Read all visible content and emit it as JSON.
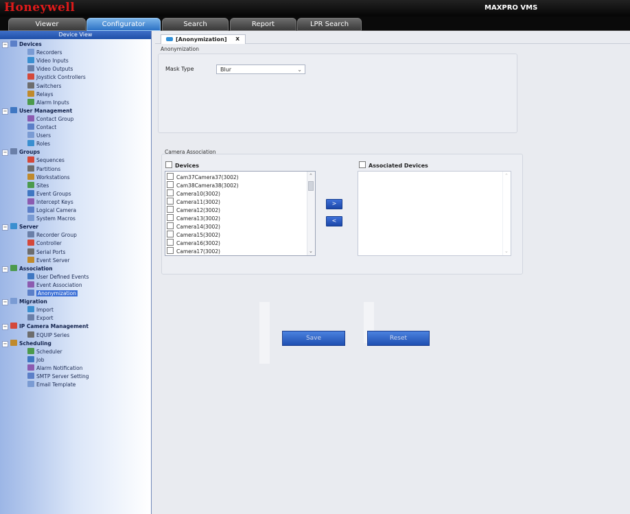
{
  "header": {
    "brand": "Honeywell",
    "product": "MAXPRO VMS",
    "tabs": [
      {
        "label": "Viewer",
        "active": false
      },
      {
        "label": "Configurator",
        "active": true
      },
      {
        "label": "Search",
        "active": false
      },
      {
        "label": "Report",
        "active": false
      },
      {
        "label": "LPR Search",
        "active": false
      }
    ]
  },
  "sidebar": {
    "title": "Device View",
    "items": [
      {
        "label": "Devices",
        "group": true
      },
      {
        "label": "Recorders"
      },
      {
        "label": "Video Inputs"
      },
      {
        "label": "Video Outputs"
      },
      {
        "label": "Joystick Controllers"
      },
      {
        "label": "Switchers"
      },
      {
        "label": "Relays"
      },
      {
        "label": "Alarm Inputs"
      },
      {
        "label": "User Management",
        "group": true
      },
      {
        "label": "Contact Group"
      },
      {
        "label": "Contact"
      },
      {
        "label": "Users"
      },
      {
        "label": "Roles"
      },
      {
        "label": "Groups",
        "group": true
      },
      {
        "label": "Sequences"
      },
      {
        "label": "Partitions"
      },
      {
        "label": "Workstations"
      },
      {
        "label": "Sites"
      },
      {
        "label": "Event Groups"
      },
      {
        "label": "Intercept Keys"
      },
      {
        "label": "Logical Camera"
      },
      {
        "label": "System Macros"
      },
      {
        "label": "Server",
        "group": true
      },
      {
        "label": "Recorder Group"
      },
      {
        "label": "Controller"
      },
      {
        "label": "Serial Ports"
      },
      {
        "label": "Event Server"
      },
      {
        "label": "Association",
        "group": true
      },
      {
        "label": "User Defined Events"
      },
      {
        "label": "Event Association"
      },
      {
        "label": "Anonymization",
        "selected": true
      },
      {
        "label": "Migration",
        "group": true
      },
      {
        "label": "Import"
      },
      {
        "label": "Export"
      },
      {
        "label": "IP Camera Management",
        "group": true
      },
      {
        "label": "EQUIP Series"
      },
      {
        "label": "Scheduling",
        "group": true
      },
      {
        "label": "Scheduler"
      },
      {
        "label": "Job"
      },
      {
        "label": "Alarm Notification"
      },
      {
        "label": "SMTP Server Setting"
      },
      {
        "label": "Email Template"
      }
    ]
  },
  "doc_tab": {
    "label": "[Anonymization]",
    "close": "x"
  },
  "anonymization": {
    "section_title": "Anonymization",
    "mask_type_label": "Mask Type",
    "mask_type_value": "Blur"
  },
  "camera_association": {
    "section_title": "Camera Association",
    "devices_label": "Devices",
    "associated_label": "Associated Devices",
    "devices": [
      "Cam37Camera37(3002)",
      "Cam38Camera38(3002)",
      "Camera10(3002)",
      "Camera11(3002)",
      "Camera12(3002)",
      "Camera13(3002)",
      "Camera14(3002)",
      "Camera15(3002)",
      "Camera16(3002)",
      "Camera17(3002)"
    ],
    "add_label": ">",
    "remove_label": "<"
  },
  "actions": {
    "save": "Save",
    "reset": "Reset"
  },
  "colors": {
    "accent": "#2d72c4",
    "brand": "#e01a1a",
    "button": "#1f4fb1"
  }
}
